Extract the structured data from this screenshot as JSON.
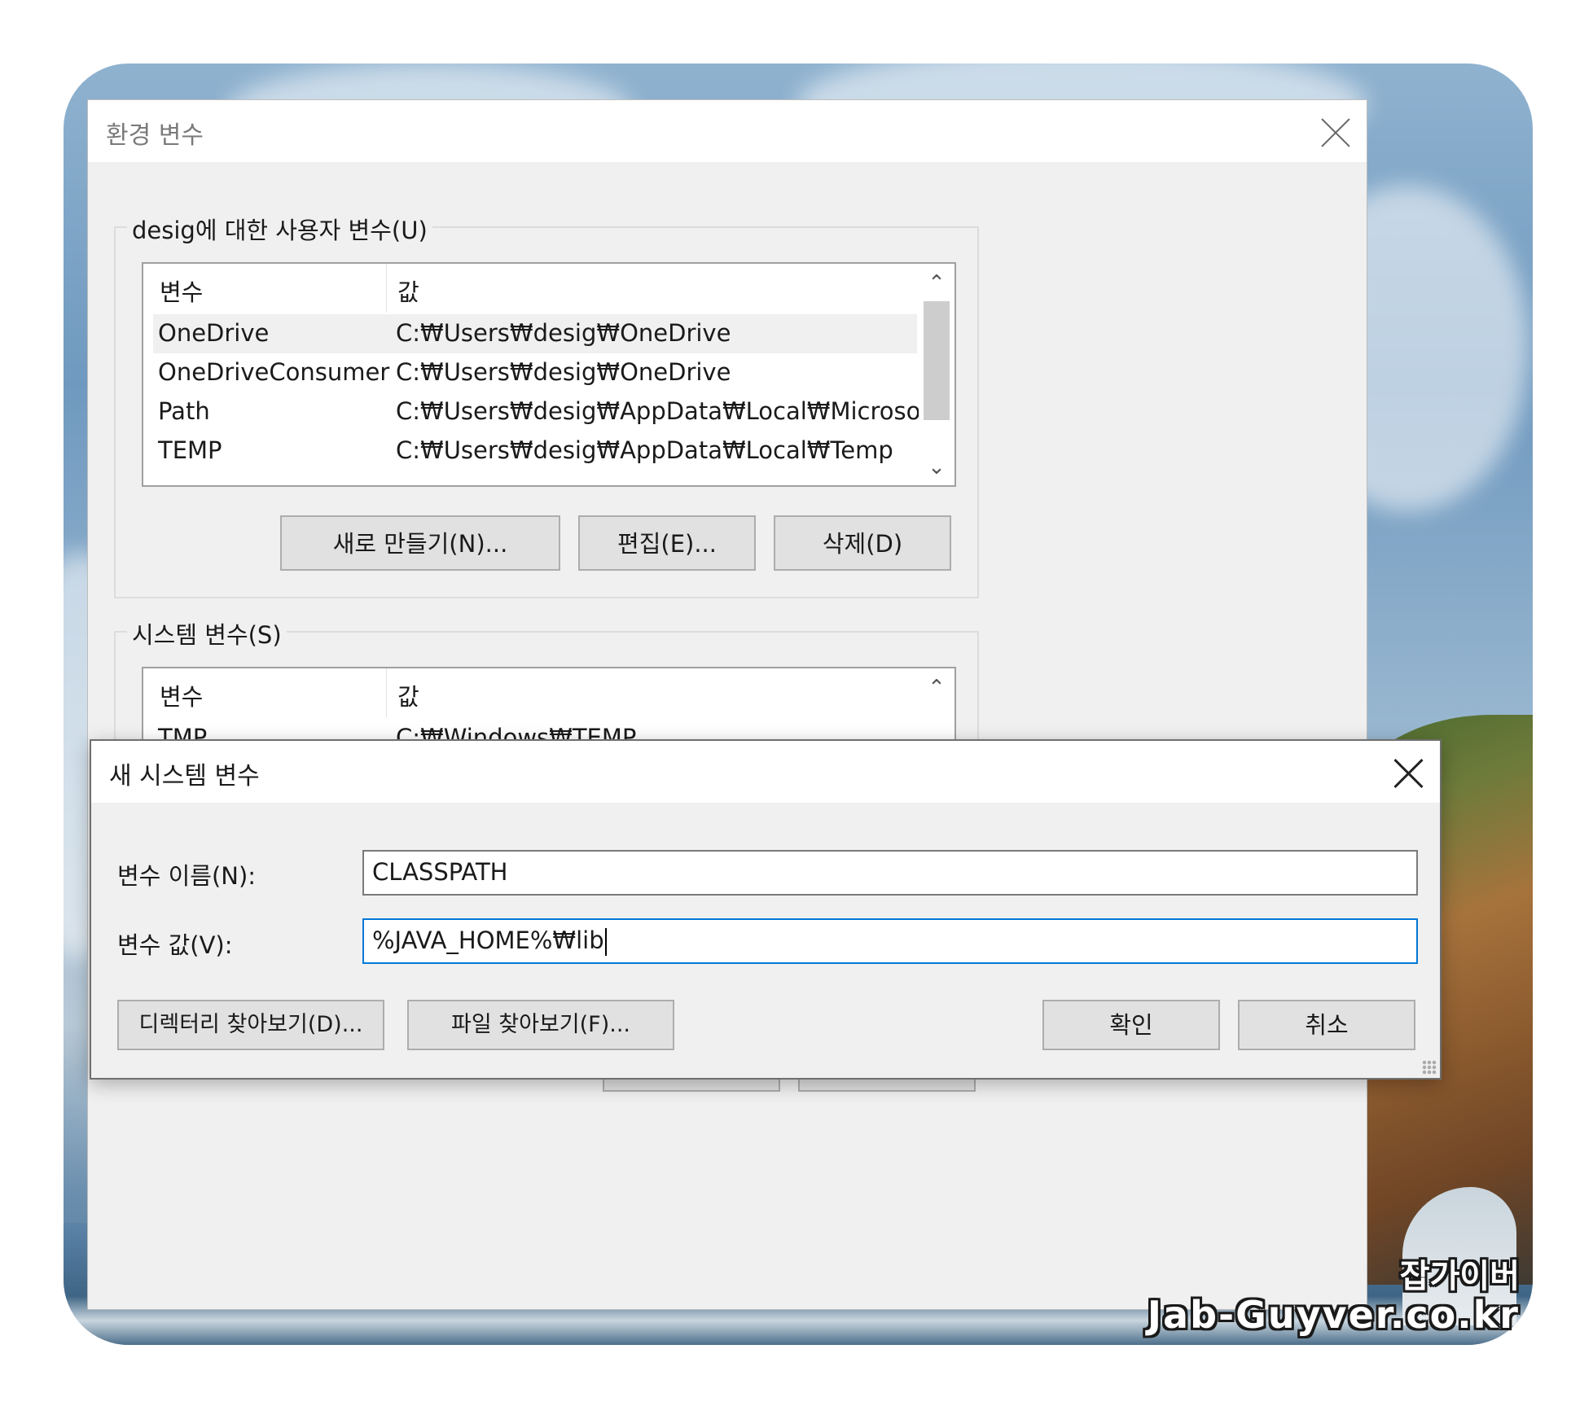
{
  "env_dialog": {
    "title": "환경 변수",
    "user_group": {
      "label": "desig에 대한 사용자 변수(U)",
      "columns": [
        "변수",
        "값"
      ],
      "rows": [
        {
          "name": "OneDrive",
          "value": "C:₩Users₩desig₩OneDrive"
        },
        {
          "name": "OneDriveConsumer",
          "value": "C:₩Users₩desig₩OneDrive"
        },
        {
          "name": "Path",
          "value": "C:₩Users₩desig₩AppData₩Local₩Microsof..."
        },
        {
          "name": "TEMP",
          "value": "C:₩Users₩desig₩AppData₩Local₩Temp"
        }
      ],
      "buttons": {
        "new": "새로 만들기(N)...",
        "edit": "편집(E)...",
        "delete": "삭제(D)"
      }
    },
    "system_group": {
      "label": "시스템 변수(S)",
      "columns": [
        "변수",
        "값"
      ],
      "rows": [
        {
          "name": "TMP",
          "value": "C:₩Windows₩TEMP"
        }
      ]
    }
  },
  "new_dialog": {
    "title": "새 시스템 변수",
    "name_label": "변수 이름(N):",
    "name_value": "CLASSPATH",
    "value_label": "변수 값(V):",
    "value_value": "%JAVA_HOME%₩lib",
    "buttons": {
      "browse_dir": "디렉터리 찾아보기(D)...",
      "browse_file": "파일 찾아보기(F)...",
      "ok": "확인",
      "cancel": "취소"
    }
  },
  "watermark": {
    "line1": "잡가이버",
    "line2": "Jab-Guyver.co.kr"
  },
  "colors": {
    "focus_border": "#0078d7",
    "dialog_bg": "#f0f0f0",
    "button_bg": "#e1e1e1"
  },
  "icons": [
    "close-icon",
    "scroll-up-icon",
    "scroll-down-icon",
    "resize-grip-icon"
  ]
}
